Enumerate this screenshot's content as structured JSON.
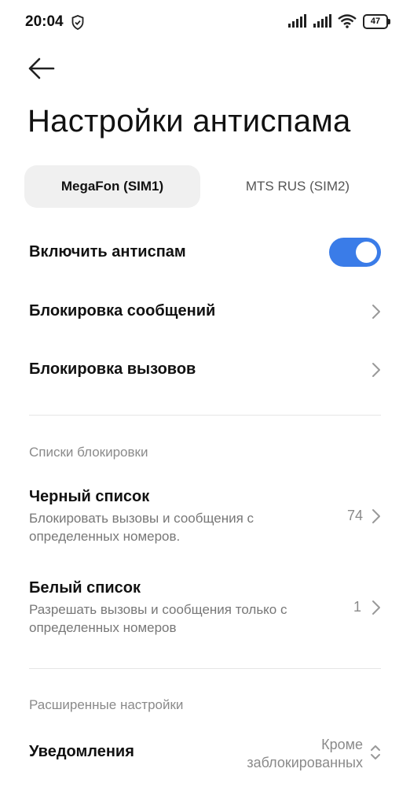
{
  "status_bar": {
    "time": "20:04",
    "battery": "47",
    "icons": [
      "shield-icon",
      "signal-sim1-icon",
      "signal-sim2-icon",
      "wifi-icon",
      "battery-icon"
    ]
  },
  "page": {
    "title": "Настройки антиспама",
    "back_icon": "arrow-left-icon"
  },
  "sim_tabs": [
    {
      "label": "MegaFon (SIM1)",
      "active": true
    },
    {
      "label": "MTS RUS (SIM2)",
      "active": false
    }
  ],
  "settings": {
    "enable_antispam": {
      "label": "Включить антиспам",
      "on": true
    },
    "block_messages": {
      "label": "Блокировка сообщений"
    },
    "block_calls": {
      "label": "Блокировка вызовов"
    }
  },
  "lists_section": {
    "header": "Списки блокировки",
    "blacklist": {
      "title": "Черный список",
      "subtitle": "Блокировать вызовы и сообщения с определенных номеров.",
      "count": "74"
    },
    "whitelist": {
      "title": "Белый список",
      "subtitle": "Разрешать вызовы и сообщения только с определенных номеров",
      "count": "1"
    }
  },
  "advanced_section": {
    "header": "Расширенные настройки",
    "notifications": {
      "title": "Уведомления",
      "value_line1": "Кроме",
      "value_line2": "заблокированных"
    }
  },
  "colors": {
    "accent": "#3a7ce8",
    "tab_active_bg": "#f0f0f0",
    "secondary_text": "#8a8a8a"
  }
}
